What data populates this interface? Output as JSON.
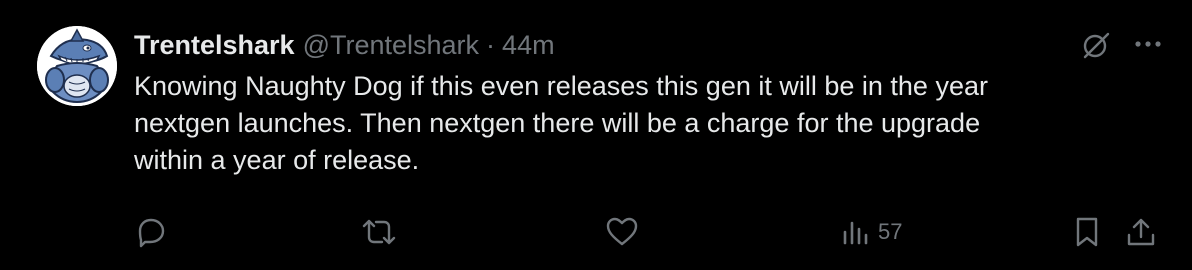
{
  "tweet": {
    "display_name": "Trentelshark",
    "handle": "@Trentelshark",
    "separator": "·",
    "time": "44m",
    "text": "Knowing Naughty Dog if this even releases this gen it will be in the year\nnextgen launches. Then nextgen there will be a charge for the upgrade\nwithin a year of release."
  },
  "actions": {
    "reply_icon": "reply-icon",
    "repost_icon": "repost-icon",
    "like_icon": "heart-icon",
    "views_icon": "views-icon",
    "views_count": "57",
    "bookmark_icon": "bookmark-icon",
    "share_icon": "share-icon"
  },
  "header_icons": {
    "grok": "grok-icon",
    "more": "more-icon"
  },
  "colors": {
    "background": "#000000",
    "primary_text": "#e7e9ea",
    "secondary_text": "#71767b",
    "icon": "#71767b"
  }
}
